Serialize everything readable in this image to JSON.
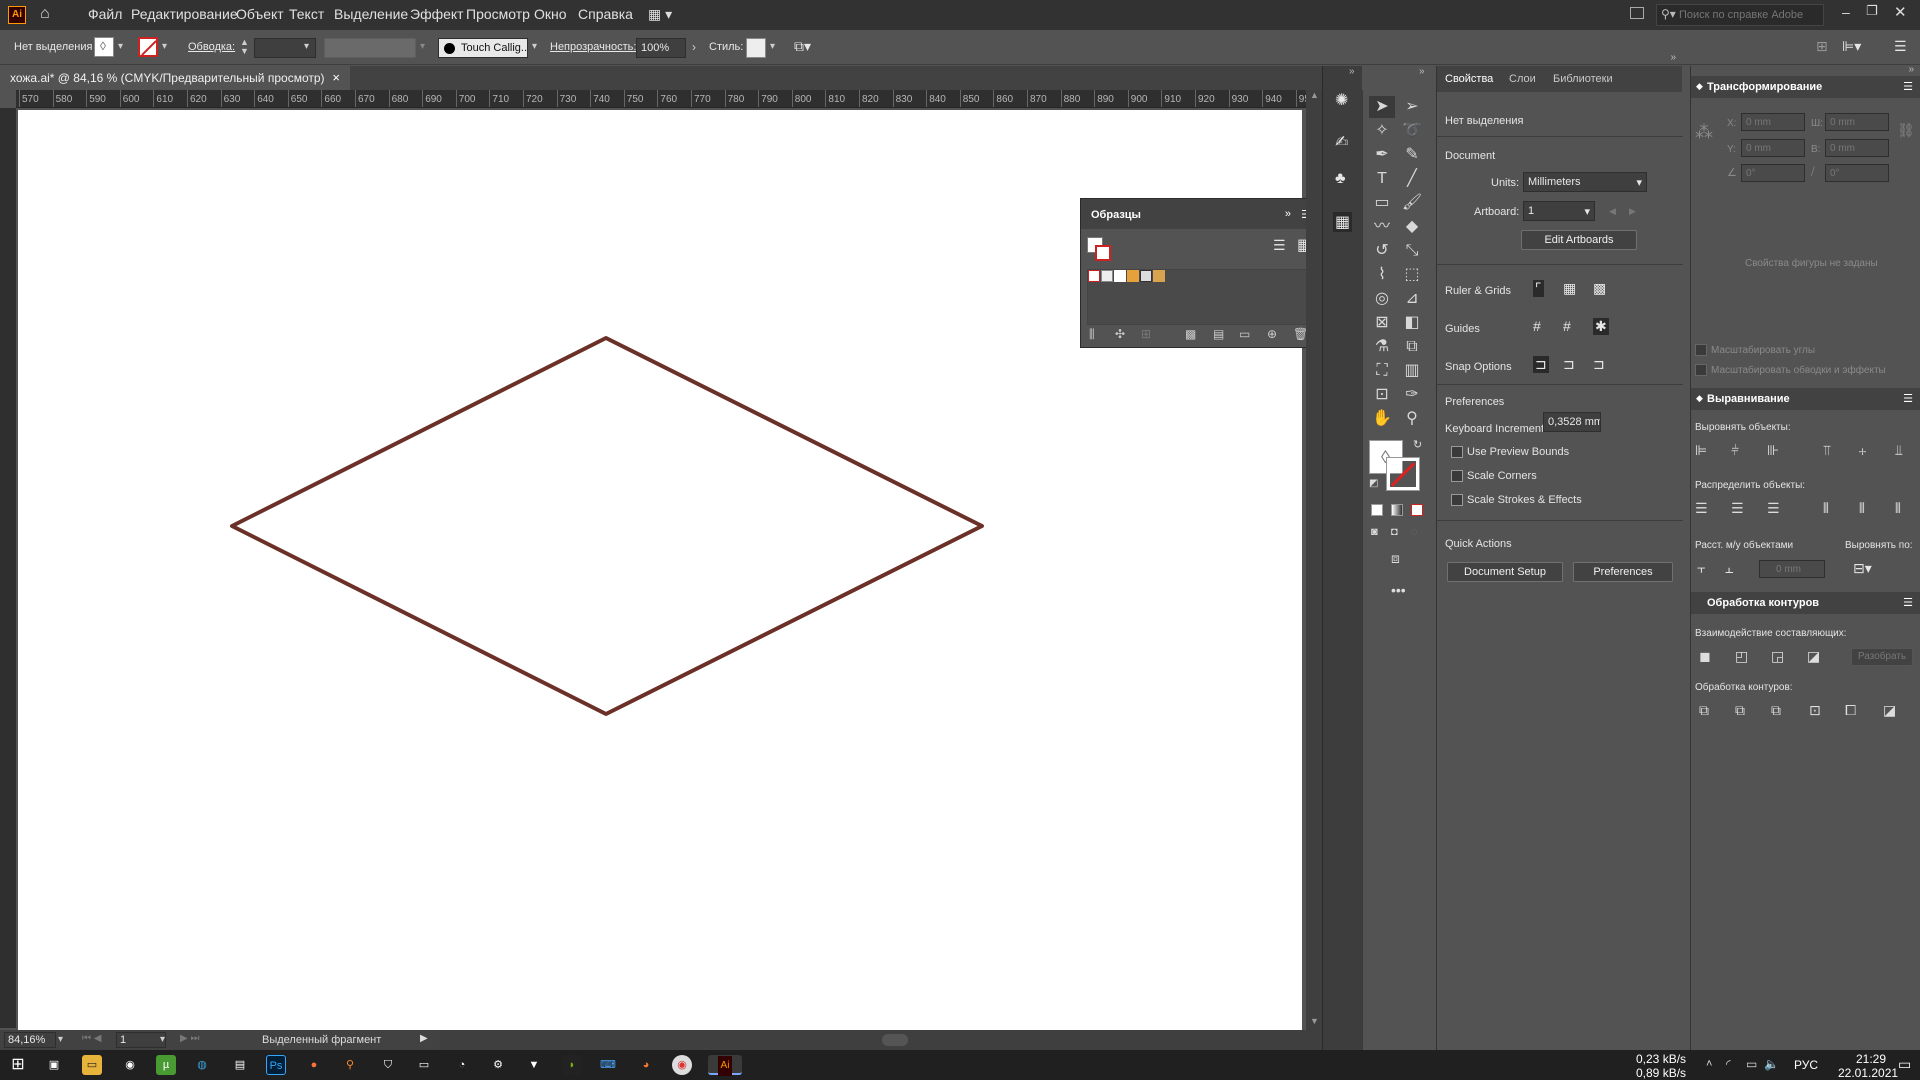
{
  "app": {
    "logo": "Ai",
    "accent": "#ff9a00"
  },
  "menu": [
    "Файл",
    "Редактирование",
    "Объект",
    "Текст",
    "Выделение",
    "Эффект",
    "Просмотр",
    "Окно",
    "Справка"
  ],
  "help_search": {
    "placeholder": "Поиск по справке Adobe"
  },
  "control": {
    "selection": "Нет выделения",
    "stroke_label": "Обводка:",
    "brush": "Touch Callig...",
    "opacity_label": "Непрозрачность:",
    "opacity": "100%",
    "style_label": "Стиль:"
  },
  "document_tab": {
    "title": "хожа.ai* @ 84,16 % (CMYK/Предварительный просмотр)",
    "close": "×"
  },
  "ruler_ticks": [
    "570",
    "580",
    "590",
    "600",
    "610",
    "620",
    "630",
    "640",
    "650",
    "660",
    "670",
    "680",
    "690",
    "700",
    "710",
    "720",
    "730",
    "740",
    "750",
    "760",
    "770",
    "780",
    "790",
    "800",
    "810",
    "820",
    "830",
    "840",
    "850",
    "860",
    "870",
    "880",
    "890",
    "900",
    "910",
    "920",
    "930",
    "940",
    "95"
  ],
  "status": {
    "zoom": "84,16%",
    "artboard": "1",
    "info": "Выделенный фрагмент"
  },
  "artwork": {
    "stroke_color": "#6b3027"
  },
  "swatches_panel": {
    "title": "Образцы"
  },
  "properties": {
    "tabs": [
      "Свойства",
      "Слои",
      "Библиотеки"
    ],
    "no_selection": "Нет выделения",
    "document_heading": "Document",
    "units_label": "Units:",
    "units_value": "Millimeters",
    "artboard_label": "Artboard:",
    "artboard_value": "1",
    "edit_artboards": "Edit Artboards",
    "ruler_grids": "Ruler & Grids",
    "guides": "Guides",
    "snap_options": "Snap Options",
    "preferences_heading": "Preferences",
    "keyboard_increment_label": "Keyboard Increment:",
    "keyboard_increment_value": "0,3528 mm",
    "use_preview_bounds": "Use Preview Bounds",
    "scale_corners": "Scale Corners",
    "scale_strokes": "Scale Strokes & Effects",
    "quick_actions": "Quick Actions",
    "document_setup": "Document Setup",
    "preferences_button": "Preferences"
  },
  "transform": {
    "title": "Трансформирование",
    "x_label": "X:",
    "y_label": "Y:",
    "w_label": "Ш:",
    "h_label": "В:",
    "x": "0 mm",
    "y": "0 mm",
    "w": "0 mm",
    "h": "0 mm",
    "angle": "0°",
    "shear": "0°",
    "shape_note": "Свойства фигуры не заданы",
    "scale_corners": "Масштабировать углы",
    "scale_strokes": "Масштабировать обводки и эффекты"
  },
  "align": {
    "title": "Выравнивание",
    "align_objects": "Выровнять объекты:",
    "distribute_objects": "Распределить объекты:",
    "distribute_spacing": "Расст. м/у объектами",
    "align_to": "Выровнять по:",
    "spacing_value": "0 mm"
  },
  "pathfinder": {
    "title": "Обработка контуров",
    "shape_modes": "Взаимодействие составляющих:",
    "expand": "Разобрать",
    "pathfinders": "Обработка контуров:"
  },
  "taskbar": {
    "upload": "0,23 kB/s",
    "download": "0,89 kB/s",
    "lang": "РУС",
    "time": "21:29",
    "date": "22.01.2021"
  }
}
